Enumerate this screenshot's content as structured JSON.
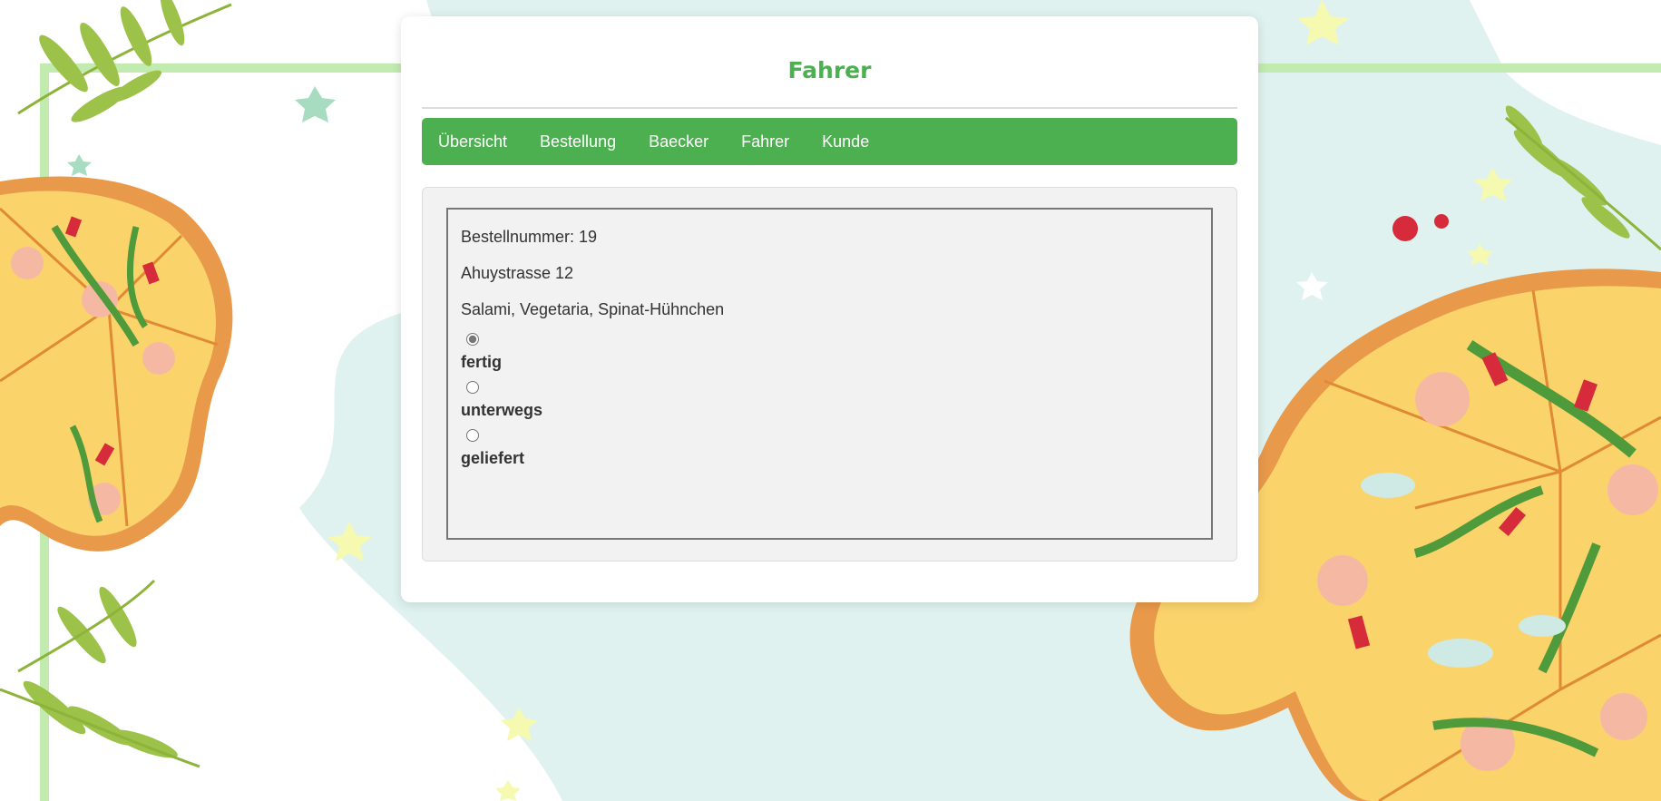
{
  "page": {
    "title": "Fahrer"
  },
  "nav": {
    "items": [
      {
        "label": "Übersicht"
      },
      {
        "label": "Bestellung"
      },
      {
        "label": "Baecker"
      },
      {
        "label": "Fahrer"
      },
      {
        "label": "Kunde"
      }
    ]
  },
  "order": {
    "number_line": "Bestellnummer: 19",
    "address": "Ahuystrasse 12",
    "pizzas": "Salami, Vegetaria, Spinat-Hühnchen",
    "status_options": [
      {
        "label": "fertig",
        "checked": true
      },
      {
        "label": "unterwegs",
        "checked": false
      },
      {
        "label": "geliefert",
        "checked": false
      }
    ]
  },
  "colors": {
    "accent": "#4caf50",
    "background_mint": "#dff2ef",
    "frame_green": "#b9e6a8"
  },
  "background": {
    "illustration": "pizza-slices-with-shrimp-and-leaves"
  }
}
